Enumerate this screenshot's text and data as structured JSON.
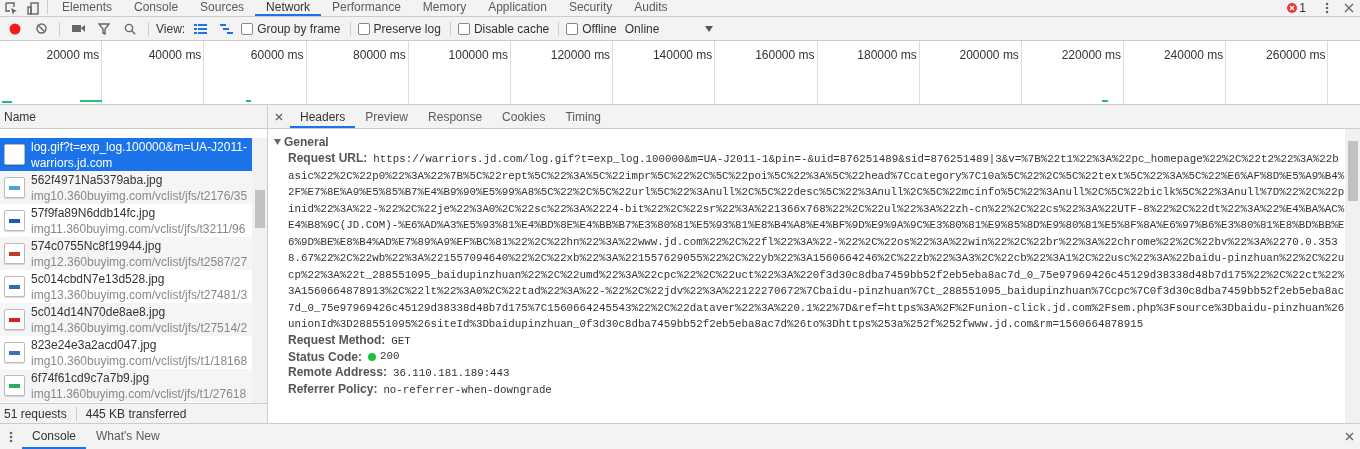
{
  "top_tabs": [
    {
      "label": "Elements",
      "selected": false
    },
    {
      "label": "Console",
      "selected": false
    },
    {
      "label": "Sources",
      "selected": false
    },
    {
      "label": "Network",
      "selected": true
    },
    {
      "label": "Performance",
      "selected": false
    },
    {
      "label": "Memory",
      "selected": false
    },
    {
      "label": "Application",
      "selected": false
    },
    {
      "label": "Security",
      "selected": false
    },
    {
      "label": "Audits",
      "selected": false
    }
  ],
  "error_count": "1",
  "toolbar": {
    "recording": true,
    "view_label": "View:",
    "large_rows": true,
    "overview": true,
    "checkboxes": [
      {
        "label": "Group by frame",
        "checked": false
      },
      {
        "label": "Preserve log",
        "checked": false
      },
      {
        "label": "Disable cache",
        "checked": false
      },
      {
        "label": "Offline",
        "checked": false
      }
    ],
    "throttle": "Online"
  },
  "timeline": {
    "ticks": [
      "20000 ms",
      "40000 ms",
      "60000 ms",
      "80000 ms",
      "100000 ms",
      "120000 ms",
      "140000 ms",
      "160000 ms",
      "180000 ms",
      "200000 ms",
      "220000 ms",
      "240000 ms",
      "260000 ms"
    ]
  },
  "requests": {
    "column": "Name",
    "rows": [
      {
        "kind": "document",
        "name": "log.gif?t=exp_log.100000&m=UA-J2011-",
        "url": "warriors.jd.com",
        "selected": true
      },
      {
        "kind": "image",
        "color": "#4aa3df",
        "name": "562f4971Na5379aba.jpg",
        "url": "img10.360buyimg.com/vclist/jfs/t2176/35",
        "selected": false
      },
      {
        "kind": "image",
        "color": "#1a5fb4",
        "name": "57f9fa89N6ddb14fc.jpg",
        "url": "img11.360buyimg.com/vclist/jfs/t3211/96",
        "selected": false
      },
      {
        "kind": "image",
        "color": "#c0392b",
        "name": "574c0755Nc8f19944.jpg",
        "url": "img12.360buyimg.com/vclist/jfs/t2587/27",
        "selected": false
      },
      {
        "kind": "image",
        "color": "#2e6db4",
        "name": "5c014cbdN7e13d528.jpg",
        "url": "img13.360buyimg.com/vclist/jfs/t27481/3",
        "selected": false
      },
      {
        "kind": "image",
        "color": "#e02020",
        "name": "5c014d14N70de8ae8.jpg",
        "url": "img14.360buyimg.com/vclist/jfs/t27514/2",
        "selected": false
      },
      {
        "kind": "image",
        "color": "#3b6fc4",
        "name": "823e24e3a2acd047.jpg",
        "url": "img10.360buyimg.com/vclist/jfs/t1/18168",
        "selected": false
      },
      {
        "kind": "image",
        "color": "#27ae60",
        "name": "6f74f61cd9c7a7b9.jpg",
        "url": "img11.360buyimg.com/vclist/jfs/t1/27618",
        "selected": false
      }
    ]
  },
  "summary": {
    "requests": "51 requests",
    "transferred": "445 KB transferred"
  },
  "detail_tabs": [
    {
      "label": "Headers",
      "selected": true
    },
    {
      "label": "Preview",
      "selected": false
    },
    {
      "label": "Response",
      "selected": false
    },
    {
      "label": "Cookies",
      "selected": false
    },
    {
      "label": "Timing",
      "selected": false
    }
  ],
  "general": {
    "title": "General",
    "expanded": true,
    "fields": [
      {
        "kind": "url",
        "label": "Request URL:",
        "value": "https://warriors.jd.com/log.gif?t=exp_log.100000&m=UA-J2011-1&pin=-&uid=876251489&sid=876251489|3&v=%7B%22t1%22%3A%22pc_homepage%22%2C%22t2%22%3A%22basic%22%2C%22p0%22%3A%22%7B%5C%22rept%5C%22%3A%5C%22impr%5C%22%2C%5C%22poi%5C%22%3A%5C%22head%7Ccategory%7C10a%5C%22%2C%5C%22text%5C%22%3A%5C%22%E6%AF%8D%E5%A9%B4%2F%E7%8E%A9%E5%85%B7%E4%B9%90%E5%99%A8%5C%22%2C%5C%22url%5C%22%3Anull%2C%5C%22desc%5C%22%3Anull%2C%5C%22mcinfo%5C%22%3Anull%2C%5C%22biclk%5C%22%3Anull%7D%22%2C%22pinid%22%3A%22-%22%2C%22je%22%3A0%2C%22sc%22%3A%2224-bit%22%2C%22sr%22%3A%221366x768%22%2C%22ul%22%3A%22zh-cn%22%2C%22cs%22%3A%22UTF-8%22%2C%22dt%22%3A%22%E4%BA%AC%E4%B8%9C(JD.COM)-%E6%AD%A3%E5%93%81%E4%BD%8E%E4%BB%B7%E3%80%81%E5%93%81%E8%B4%A8%E4%BF%9D%E9%9A%9C%E3%80%81%E9%85%8D%E9%80%81%E5%8F%8A%E6%97%B6%E3%80%81%E8%BD%BB%E6%9D%BE%E8%B4%AD%E7%89%A9%EF%BC%81%22%2C%22hn%22%3A%22www.jd.com%22%2C%22fl%22%3A%22-%22%2C%22os%22%3A%22win%22%2C%22br%22%3A%22chrome%22%2C%22bv%22%3A%2270.0.3538.67%22%2C%22wb%22%3A%221557094640%22%2C%22xb%22%3A%221557629055%22%2C%22yb%22%3A1560664246%2C%22zb%22%3A3%2C%22cb%22%3A1%2C%22usc%22%3A%22baidu-pinzhuan%22%2C%22ucp%22%3A%22t_288551095_baidupinzhuan%22%2C%22umd%22%3A%22cpc%22%2C%22uct%22%3A%220f3d30c8dba7459bb52f2eb5eba8ac7d_0_75e97969426c45129d38338d48b7d175%22%2C%22ct%22%3A1560664878913%2C%22lt%22%3A0%2C%22tad%22%3A%22-%22%2C%22jdv%22%3A%22122270672%7Cbaidu-pinzhuan%7Ct_288551095_baidupinzhuan%7Ccpc%7C0f3d30c8dba7459bb52f2eb5eba8ac7d_0_75e97969426c45129d38338d48b7d175%7C1560664245543%22%2C%22dataver%22%3A%220.1%22%7D&ref=https%3A%2F%2Funion-click.jd.com%2Fsem.php%3Fsource%3Dbaidu-pinzhuan%26unionId%3D288551095%26siteId%3Dbaidupinzhuan_0f3d30c8dba7459bb52f2eb5eba8ac7d%26to%3Dhttps%253a%252f%252fwww.jd.com&rm=1560664878915"
      },
      {
        "kind": "text",
        "label": "Request Method:",
        "value": "GET"
      },
      {
        "kind": "status",
        "label": "Status Code:",
        "value": "200",
        "color": "#21c140"
      },
      {
        "kind": "text",
        "label": "Remote Address:",
        "value": "36.110.181.189:443"
      },
      {
        "kind": "text",
        "label": "Referrer Policy:",
        "value": "no-referrer-when-downgrade"
      }
    ]
  },
  "drawer_tabs": [
    {
      "label": "Console",
      "selected": true
    },
    {
      "label": "What's New",
      "selected": false
    }
  ]
}
